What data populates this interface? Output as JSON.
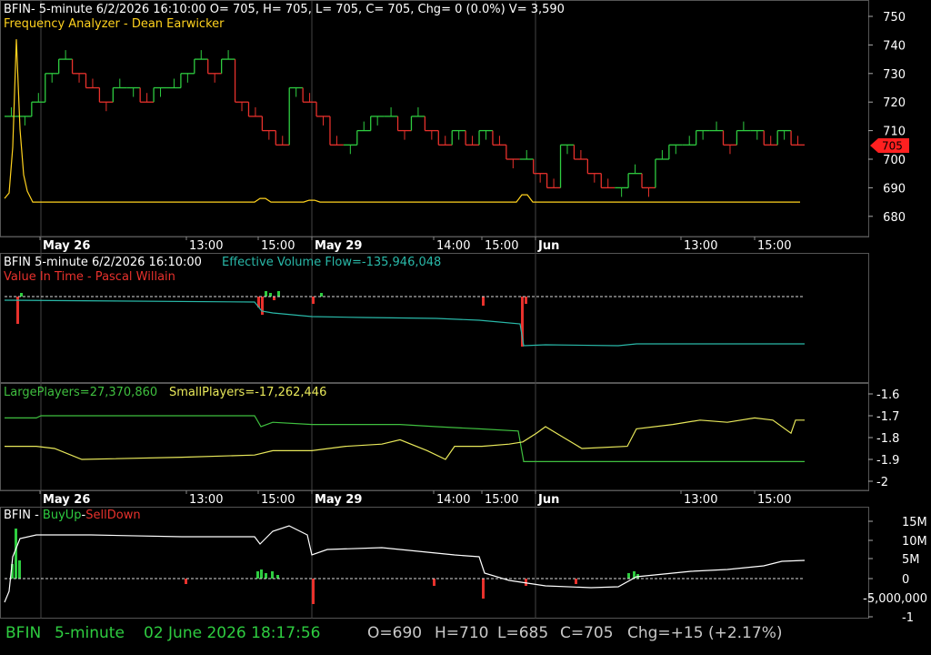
{
  "colors": {
    "up": "#2ecc40",
    "down": "#e8312c",
    "fva": "#ffd21e",
    "evf": "#29b8a8",
    "large": "#3fbf3f",
    "small": "#e8e85a",
    "white": "#ffffff",
    "grid": "#3a3a3a",
    "status_green": "#2ecc40",
    "status_gray": "#c8c8c8",
    "label_red": "#ff2020"
  },
  "panel1": {
    "header": "BFIN- 5-minute 6/2/2026 16:10:00 O= 705, H= 705, L= 705, C= 705, Chg= 0 (0.0%) V= 3,590",
    "indicator": "Frequency Analyzer - Dean Earwicker",
    "last_price": "705",
    "y_ticks": [
      "750",
      "740",
      "730",
      "720",
      "710",
      "700",
      "690",
      "680"
    ]
  },
  "date_axis": {
    "labels": [
      "May 26",
      "13:00",
      "15:00",
      "May 29",
      "14:00",
      "15:00",
      "Jun",
      "13:00",
      "15:00"
    ]
  },
  "panel2": {
    "header_left": "BFIN 5-minute  6/2/2026 16:10:00",
    "header_right": "Effective Volume Flow=-135,946,048",
    "indicator": "Value In Time - Pascal Willain"
  },
  "panel3": {
    "large_label": "LargePlayers=27,370,860",
    "small_label": "SmallPlayers=-17,262,446",
    "y_ticks": [
      "-1.6",
      "-1.7",
      "-1.8",
      "-1.9",
      "-2"
    ]
  },
  "panel4": {
    "bfin": "BFIN - ",
    "buyup": "BuyUp",
    "dash": "-",
    "selldown": "SellDown",
    "y_ticks": [
      "15M",
      "10M",
      "5M",
      "0",
      "-5,000,000",
      "-1"
    ]
  },
  "status": {
    "symbol": "BFIN",
    "interval": "5-minute",
    "datetime": "02 June 2026 18:17:56",
    "open": "O=690",
    "high": "H=710",
    "low": "L=685",
    "close": "C=705",
    "change": "Chg=+15 (+2.17%)"
  },
  "chart_data": {
    "type": "line",
    "price_steps": {
      "y_axis": [
        680,
        750
      ],
      "values": [
        715,
        715,
        720,
        730,
        735,
        730,
        725,
        720,
        725,
        725,
        720,
        725,
        725,
        730,
        735,
        730,
        735,
        720,
        715,
        710,
        705,
        725,
        720,
        715,
        705,
        705,
        710,
        715,
        715,
        710,
        715,
        710,
        705,
        710,
        705,
        710,
        705,
        700,
        700,
        695,
        690,
        705,
        700,
        695,
        690,
        690,
        695,
        690,
        700,
        705,
        705,
        710,
        710,
        705,
        710,
        710,
        705,
        710,
        705
      ]
    },
    "frequency_analyzer": {
      "peak": 742,
      "base": 685
    },
    "large_players": {
      "y_axis": [
        -2.05,
        -1.55
      ],
      "start": -1.71,
      "end": -1.91
    },
    "small_players": {
      "y_axis": [
        -2.05,
        -1.55
      ],
      "start": -1.84,
      "end": -1.72
    },
    "buyup_selldown_line": {
      "y_axis": [
        "-1",
        "15M"
      ],
      "start": "-1",
      "end": "5M"
    }
  }
}
